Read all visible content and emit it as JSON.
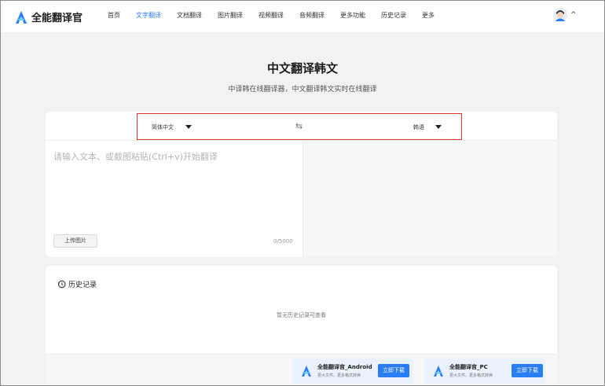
{
  "brand": {
    "name": "全能翻译官",
    "color": "#2a7ef4"
  },
  "nav": [
    {
      "label": "首页",
      "active": false
    },
    {
      "label": "文字翻译",
      "active": true
    },
    {
      "label": "文档翻译",
      "active": false
    },
    {
      "label": "图片翻译",
      "active": false
    },
    {
      "label": "视频翻译",
      "active": false
    },
    {
      "label": "音频翻译",
      "active": false
    },
    {
      "label": "更多功能",
      "active": false
    },
    {
      "label": "历史记录",
      "active": false
    },
    {
      "label": "更多",
      "active": false
    }
  ],
  "user_menu": {
    "chevron": "^"
  },
  "page": {
    "title": "中文翻译韩文",
    "subtitle": "中译韩在线翻译器，中文翻译韩文实时在线翻译"
  },
  "translator": {
    "source_lang": "简体中文",
    "target_lang": "韩语",
    "swap_icon": "⇆",
    "placeholder": "请输入文本、或截图粘贴(Ctrl+v)开始翻译",
    "upload_label": "上传图片",
    "char_count": "0/5000",
    "highlight_color": "#e0352c"
  },
  "history": {
    "title": "历史记录",
    "empty_text": "暂无历史记录可查看"
  },
  "downloads": [
    {
      "name": "全能翻译官_Android",
      "sub": "更大文件、更多格式转换",
      "button": "立即下载"
    },
    {
      "name": "全能翻译官_PC",
      "sub": "更大文件、更多格式转换",
      "button": "立即下载"
    }
  ]
}
